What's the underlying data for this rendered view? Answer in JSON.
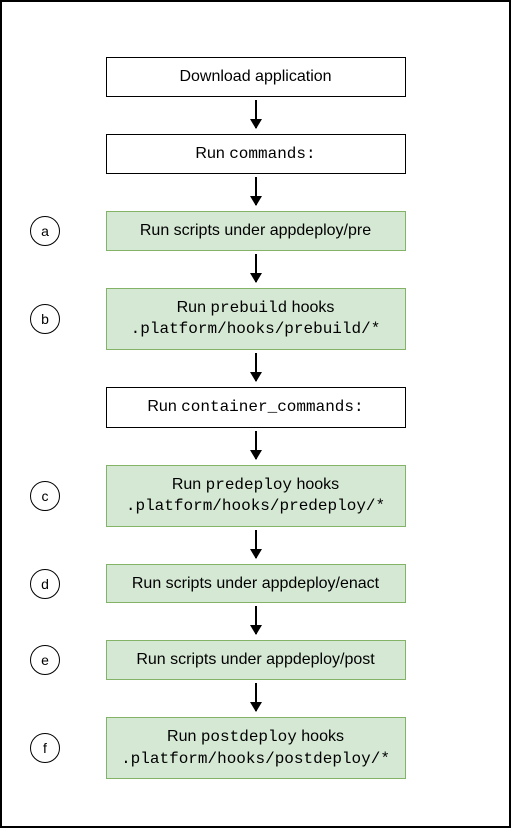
{
  "steps": {
    "s1": {
      "text": "Download application"
    },
    "s2": {
      "prefix": "Run ",
      "code": "commands:"
    },
    "s3": {
      "marker": "a",
      "text": "Run scripts under appdeploy/pre"
    },
    "s4": {
      "marker": "b",
      "l1_prefix": "Run ",
      "l1_code": "prebuild",
      "l1_suffix": " hooks",
      "l2_code": ".platform/hooks/prebuild/*"
    },
    "s5": {
      "prefix": "Run ",
      "code": "container_commands:"
    },
    "s6": {
      "marker": "c",
      "l1_prefix": "Run ",
      "l1_code": "predeploy",
      "l1_suffix": " hooks",
      "l2_code": ".platform/hooks/predeploy/*"
    },
    "s7": {
      "marker": "d",
      "text": "Run scripts under appdeploy/enact"
    },
    "s8": {
      "marker": "e",
      "text": "Run scripts under appdeploy/post"
    },
    "s9": {
      "marker": "f",
      "l1_prefix": "Run ",
      "l1_code": "postdeploy",
      "l1_suffix": " hooks",
      "l2_code": ".platform/hooks/postdeploy/*"
    }
  }
}
